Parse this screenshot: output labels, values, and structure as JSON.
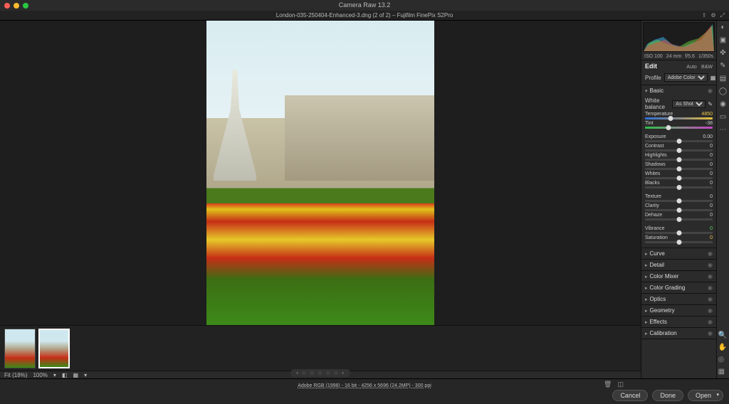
{
  "app_title": "Camera Raw 13.2",
  "document": "London-035-250404-Enhanced-3.dng (2 of 2)  –  Fujifilm FinePix S2Pro",
  "meta": {
    "iso": "ISO 100",
    "focal": "24 mm",
    "aperture": "f/5.6",
    "shutter": "1/350s"
  },
  "edit": {
    "title": "Edit",
    "auto": "Auto",
    "bw": "B&W"
  },
  "profile": {
    "label": "Profile",
    "value": "Adobe Color"
  },
  "basic": {
    "title": "Basic",
    "wb_label": "White balance",
    "wb_value": "As Shot",
    "sliders": [
      {
        "name": "Temperature",
        "value": "4850",
        "pos": 38,
        "cls": "warn",
        "track": "temp"
      },
      {
        "name": "Tint",
        "value": "-38",
        "pos": 35,
        "cls": "",
        "track": "tint"
      }
    ],
    "group2": [
      {
        "name": "Exposure",
        "value": "0.00",
        "pos": 50
      },
      {
        "name": "Contrast",
        "value": "0",
        "pos": 50
      },
      {
        "name": "Highlights",
        "value": "0",
        "pos": 50
      },
      {
        "name": "Shadows",
        "value": "0",
        "pos": 50
      },
      {
        "name": "Whites",
        "value": "0",
        "pos": 50
      },
      {
        "name": "Blacks",
        "value": "0",
        "pos": 50
      }
    ],
    "group3": [
      {
        "name": "Texture",
        "value": "0",
        "pos": 50
      },
      {
        "name": "Clarity",
        "value": "0",
        "pos": 50
      },
      {
        "name": "Dehaze",
        "value": "0",
        "pos": 50
      }
    ],
    "group4": [
      {
        "name": "Vibrance",
        "value": "0",
        "pos": 50,
        "cls": "pos"
      },
      {
        "name": "Saturation",
        "value": "0",
        "pos": 50,
        "cls": "warn"
      }
    ]
  },
  "sections": [
    "Curve",
    "Detail",
    "Color Mixer",
    "Color Grading",
    "Optics",
    "Geometry",
    "Effects",
    "Calibration"
  ],
  "bottom": {
    "fit": "Fit (18%)",
    "hundred": "100%"
  },
  "footer_meta": "Adobe RGB (1998) - 16 bit - 4256 x 5696 (24.2MP) - 300 ppi",
  "buttons": {
    "cancel": "Cancel",
    "done": "Done",
    "open": "Open"
  }
}
